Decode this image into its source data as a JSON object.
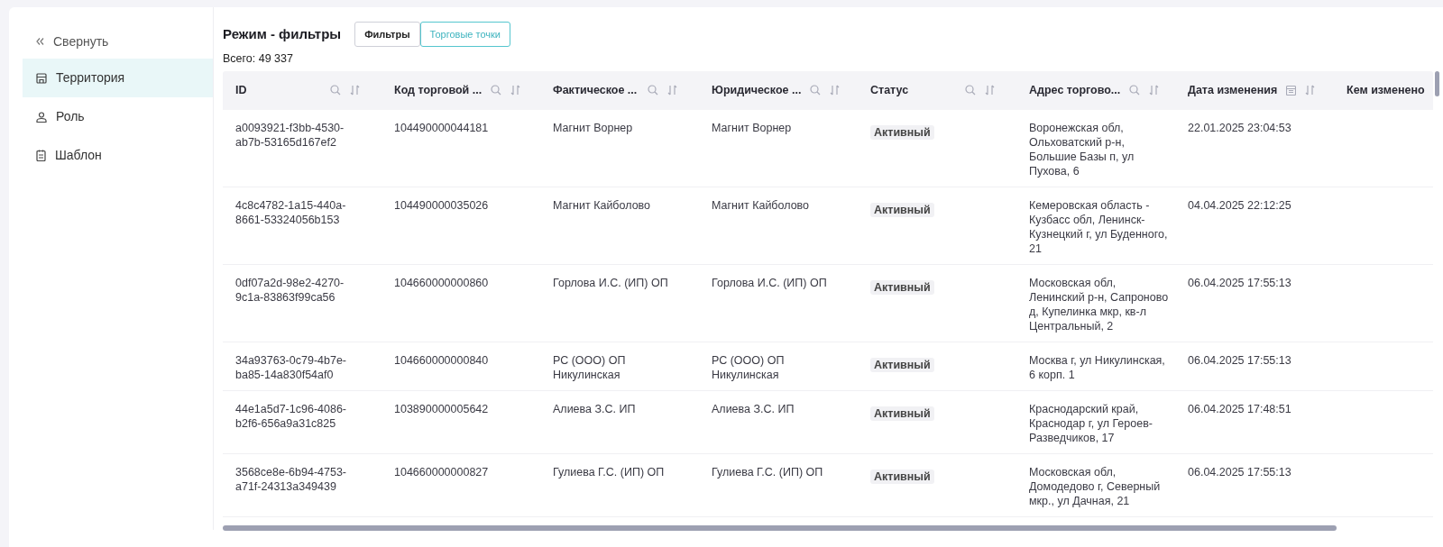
{
  "sidebar": {
    "collapse": {
      "label": "Свернуть"
    },
    "items": [
      {
        "label": "Территория",
        "kind": "store",
        "selected": true
      },
      {
        "label": "Роль",
        "kind": "person",
        "selected": false
      },
      {
        "label": "Шаблон",
        "kind": "document",
        "selected": false
      }
    ]
  },
  "header": {
    "title": "Режим - фильтры",
    "tabs": [
      {
        "label": "Фильтры",
        "selected": false
      },
      {
        "label": "Торговые точки",
        "selected": true
      }
    ],
    "total": "Всего: 49 337"
  },
  "table": {
    "columns": [
      {
        "label": "ID",
        "kind": "search"
      },
      {
        "label": "Код торговой ...",
        "kind": "search"
      },
      {
        "label": "Фактическое ...",
        "kind": "search"
      },
      {
        "label": "Юридическое ...",
        "kind": "search"
      },
      {
        "label": "Статус",
        "kind": "search"
      },
      {
        "label": "Адрес торгово...",
        "kind": "search"
      },
      {
        "label": "Дата изменения",
        "kind": "date"
      },
      {
        "label": "Кем изменено",
        "kind": "plain"
      }
    ],
    "rows": [
      {
        "id": "a0093921-f3bb-4530-ab7b-53165d167ef2",
        "code": "104490000044181",
        "actual_name": "Магнит Ворнер",
        "legal_name": "Магнит Ворнер",
        "status": "Активный",
        "address": "Воронежская обл, Ольховатский р-н, Большие Базы п, ул Пухова, 6",
        "changed": "22.01.2025 23:04:53"
      },
      {
        "id": "4c8c4782-1a15-440a-8661-53324056b153",
        "code": "104490000035026",
        "actual_name": "Магнит Кайболово",
        "legal_name": "Магнит Кайболово",
        "status": "Активный",
        "address": "Кемеровская область - Кузбасс обл, Ленинск-Кузнецкий г, ул Буденного, 21",
        "changed": "04.04.2025 22:12:25"
      },
      {
        "id": "0df07a2d-98e2-4270-9c1a-83863f99ca56",
        "code": "104660000000860",
        "actual_name": "Горлова И.С. (ИП) ОП",
        "legal_name": "Горлова И.С. (ИП) ОП",
        "status": "Активный",
        "address": "Московская обл, Ленинский р-н, Сапроново д, Купелинка мкр, кв-л Центральный, 2",
        "changed": "06.04.2025 17:55:13"
      },
      {
        "id": "34a93763-0c79-4b7e-ba85-14a830f54af0",
        "code": "104660000000840",
        "actual_name": "РС (ООО) ОП Никулинская",
        "legal_name": "РС (ООО) ОП Никулинская",
        "status": "Активный",
        "address": "Москва г, ул Никулинская, 6 корп. 1",
        "changed": "06.04.2025 17:55:13"
      },
      {
        "id": "44e1a5d7-1c96-4086-b2f6-656a9a31c825",
        "code": "103890000005642",
        "actual_name": "Алиева З.С. ИП",
        "legal_name": "Алиева З.С. ИП",
        "status": "Активный",
        "address": "Краснодарский край, Краснодар г, ул Героев-Разведчиков, 17",
        "changed": "06.04.2025 17:48:51"
      },
      {
        "id": "3568ce8e-6b94-4753-a71f-24313a349439",
        "code": "104660000000827",
        "actual_name": "Гулиева Г.С. (ИП) ОП",
        "legal_name": "Гулиева Г.С. (ИП) ОП",
        "status": "Активный",
        "address": "Московская обл, Домодедово г, Северный мкр., ул Дачная, 21",
        "changed": "06.04.2025 17:55:13"
      }
    ]
  }
}
